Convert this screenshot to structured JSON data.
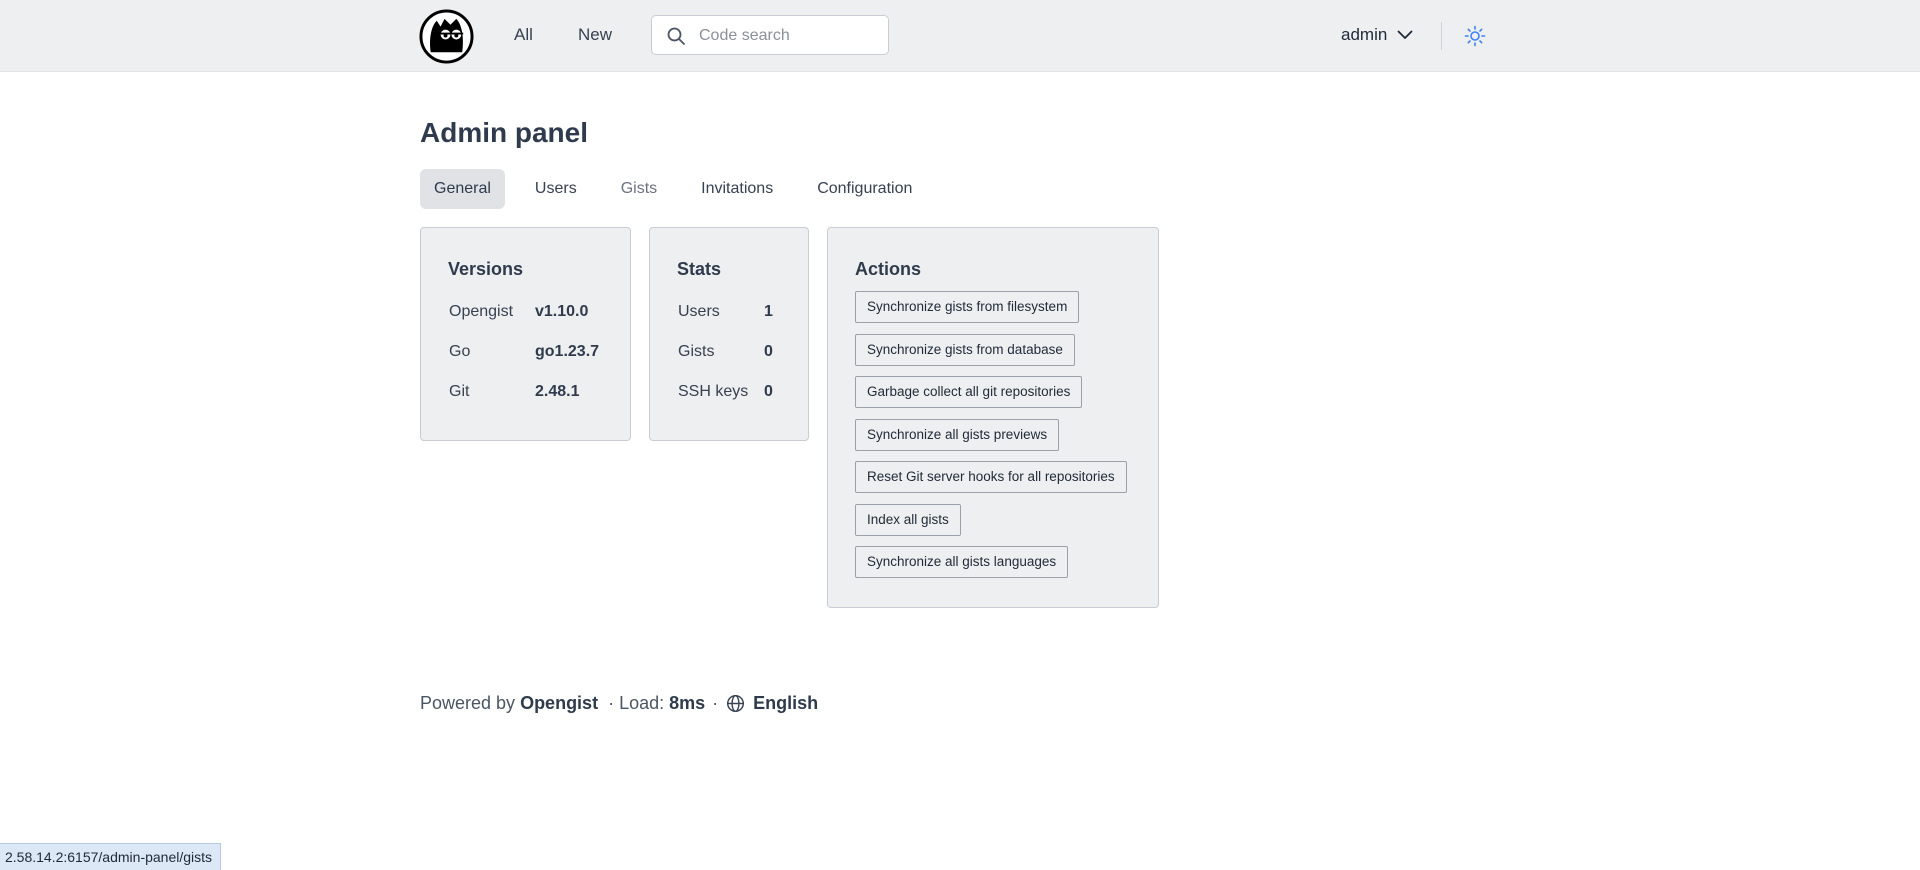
{
  "header": {
    "nav": {
      "all": "All",
      "new": "New"
    },
    "search": {
      "placeholder": "Code search",
      "value": ""
    },
    "user": {
      "name": "admin"
    },
    "icons": {
      "logo": "opengist-logo",
      "search": "search-icon",
      "chevron": "chevron-down-icon",
      "theme": "sun-icon"
    }
  },
  "main": {
    "title": "Admin panel",
    "tabs": [
      {
        "label": "General",
        "active": true
      },
      {
        "label": "Users",
        "active": false
      },
      {
        "label": "Gists",
        "active": false
      },
      {
        "label": "Invitations",
        "active": false
      },
      {
        "label": "Configuration",
        "active": false
      }
    ],
    "versions": {
      "title": "Versions",
      "rows": [
        {
          "label": "Opengist",
          "value": "v1.10.0"
        },
        {
          "label": "Go",
          "value": "go1.23.7"
        },
        {
          "label": "Git",
          "value": "2.48.1"
        }
      ]
    },
    "stats": {
      "title": "Stats",
      "rows": [
        {
          "label": "Users",
          "value": "1"
        },
        {
          "label": "Gists",
          "value": "0"
        },
        {
          "label": "SSH keys",
          "value": "0"
        }
      ]
    },
    "actions": {
      "title": "Actions",
      "buttons": [
        "Synchronize gists from filesystem",
        "Synchronize gists from database",
        "Garbage collect all git repositories",
        "Synchronize all gists previews",
        "Reset Git server hooks for all repositories",
        "Index all gists",
        "Synchronize all gists languages"
      ]
    }
  },
  "footer": {
    "powered_by": "Powered by",
    "brand": "Opengist",
    "load_label": "· Load:",
    "load_value": "8ms",
    "sep": "·",
    "language": "English"
  },
  "status_bar": {
    "url": "2.58.14.2:6157/admin-panel/gists"
  },
  "colors": {
    "topbar_bg": "#eeeff1",
    "card_bg": "#eeeff1",
    "title": "#2f3b4c",
    "theme_icon": "#3b82f6",
    "status_bg": "#dde8f7"
  }
}
